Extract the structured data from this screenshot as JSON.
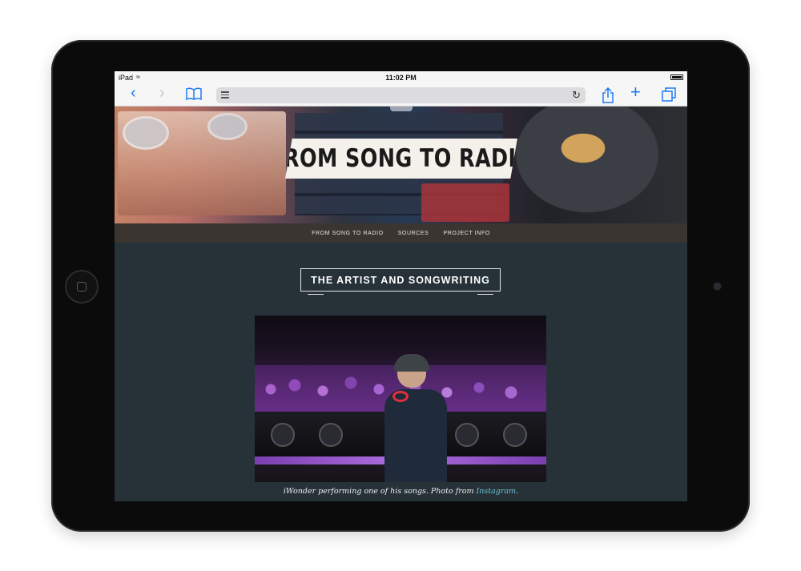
{
  "status_bar": {
    "device": "iPad",
    "time": "11:02 PM"
  },
  "toolbar": {
    "back_icon": "chevron-left-icon",
    "forward_icon": "chevron-right-icon",
    "bookmarks_icon": "book-icon",
    "reader_icon": "reader-lines-icon",
    "reload_icon": "reload-icon",
    "share_icon": "share-icon",
    "new_tab_icon": "plus-icon",
    "tabs_icon": "tabs-icon",
    "accent_color": "#1a7cf5"
  },
  "site": {
    "title": "FROM SONG TO RADIO",
    "nav": [
      {
        "label": "FROM SONG TO RADIO"
      },
      {
        "label": "SOURCES"
      },
      {
        "label": "PROJECT INFO"
      }
    ],
    "section_heading": "THE ARTIST AND SONGWRITING",
    "caption_text": "iWonder performing one of his songs. Photo from ",
    "caption_link": "Instagram",
    "caption_end": "."
  }
}
